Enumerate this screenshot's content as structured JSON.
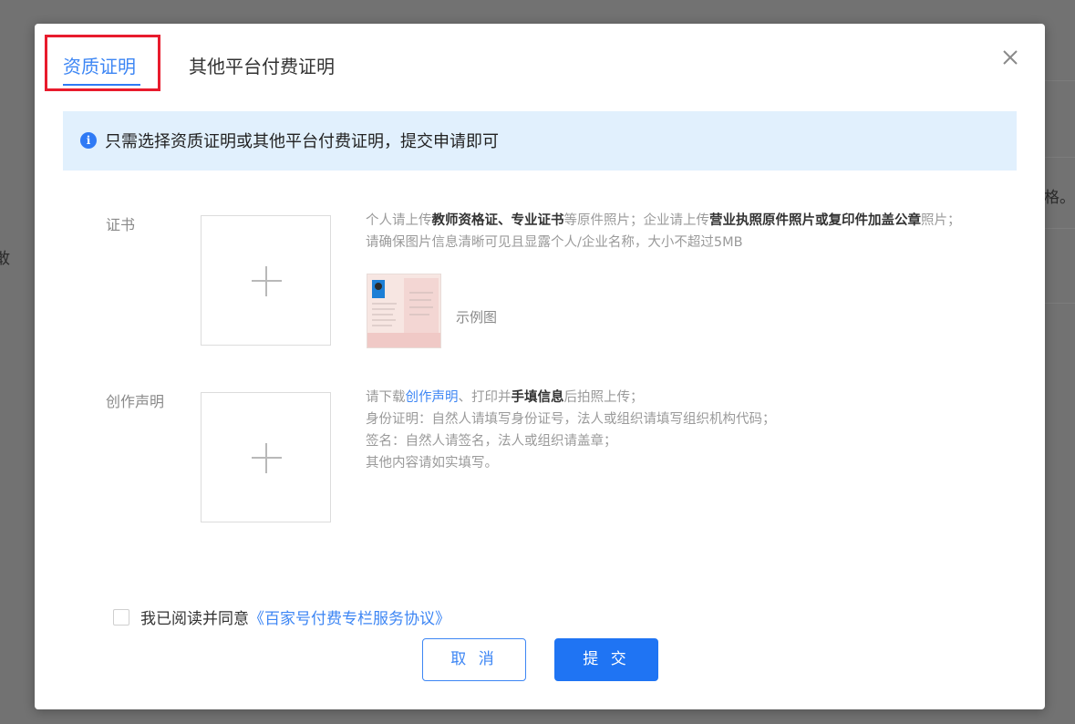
{
  "background": {
    "left_char": "敢",
    "right_char": "格。"
  },
  "tabs": [
    {
      "label": "资质证明",
      "active": true
    },
    {
      "label": "其他平台付费证明",
      "active": false
    }
  ],
  "close": {
    "icon": "close-icon"
  },
  "notice": {
    "icon": "info-icon",
    "icon_glyph": "i",
    "text": "只需选择资质证明或其他平台付费证明，提交申请即可"
  },
  "certificate": {
    "label": "证书",
    "desc_line1_a": "个人请上传",
    "desc_line1_b": "教师资格证、专业证书",
    "desc_line1_c": "等原件照片；企业请上传",
    "desc_line1_d": "营业执照原件照片或复印件加盖公章",
    "desc_line1_e": "照片；",
    "desc_line2": "请确保图片信息清晰可见且显露个人/企业名称，大小不超过5MB",
    "sample_label": "示例图"
  },
  "statement": {
    "label": "创作声明",
    "line1_a": "请下载",
    "line1_link": "创作声明",
    "line1_b": "、打印并",
    "line1_strong": "手填信息",
    "line1_c": "后拍照上传；",
    "line2": "身份证明：自然人请填写身份证号，法人或组织请填写组织机构代码；",
    "line3": "签名：自然人请签名，法人或组织请盖章；",
    "line4": "其他内容请如实填写。"
  },
  "agreement": {
    "prefix": "我已阅读并同意",
    "link": "《百家号付费专栏服务协议》"
  },
  "buttons": {
    "cancel": "取 消",
    "submit": "提 交"
  },
  "colors": {
    "accent": "#3d86f4",
    "highlight_border": "#e81b2d",
    "notice_bg": "#e1f0fd"
  }
}
